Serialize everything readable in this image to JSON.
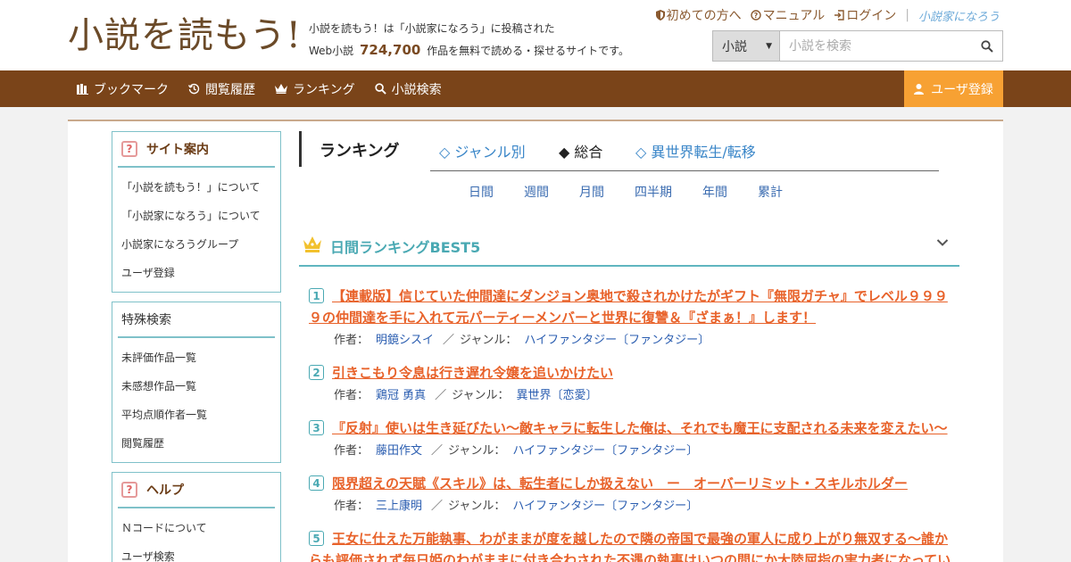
{
  "header": {
    "logo": "小説を読もう!",
    "tagline_1": "小説を読もう！は「小説家になろう」に投稿された",
    "tagline_2_prefix": "Web小説",
    "work_count": "724,700",
    "tagline_2_suffix": "作品を無料で読める・探せるサイトです。"
  },
  "topnav": {
    "beginners": "初めての方へ",
    "manual": "マニュアル",
    "login": "ログイン",
    "brand": "小説家になろう"
  },
  "search": {
    "select_value": "小説",
    "placeholder": "小説を検索"
  },
  "mainnav": {
    "bookmark": "ブックマーク",
    "history": "閲覧履歴",
    "ranking": "ランキング",
    "search": "小説検索",
    "register": "ユーザ登録"
  },
  "sidebar": {
    "site_guide": {
      "heading": "サイト案内",
      "items": [
        "「小説を読もう！」について",
        "「小説家になろう」について",
        "小説家になろうグループ",
        "ユーザ登録"
      ]
    },
    "special_search": {
      "heading": "特殊検索",
      "items": [
        "未評価作品一覧",
        "未感想作品一覧",
        "平均点順作者一覧",
        "閲覧履歴"
      ]
    },
    "help": {
      "heading": "ヘルプ",
      "items": [
        "Ｎコードについて",
        "ユーザ検索"
      ]
    }
  },
  "ranking": {
    "title": "ランキング",
    "tabs": [
      "◇ ジャンル別",
      "◆ 総合",
      "◇ 異世界転生/転移"
    ],
    "periods": [
      "日間",
      "週間",
      "月間",
      "四半期",
      "年間",
      "累計"
    ],
    "best_title": "日間ランキングBEST5",
    "author_label": "作者：",
    "genre_label": "ジャンル：",
    "entries": [
      {
        "rank": "1",
        "title": "【連載版】信じていた仲間達にダンジョン奥地で殺されかけたがギフト『無限ガチャ』でレベル９９９９の仲間達を手に入れて元パーティーメンバーと世界に復讐＆『ざまぁ！』します！",
        "author": "明鏡シスイ",
        "genre": "ハイファンタジー〔ファンタジー〕"
      },
      {
        "rank": "2",
        "title": "引きこもり令息は行き遅れ令嬢を追いかけたい",
        "author": "鶏冠 勇真",
        "genre": "異世界〔恋愛〕"
      },
      {
        "rank": "3",
        "title": "『反射』使いは生き延びたい～敵キャラに転生した俺は、それでも魔王に支配される未来を変えたい～",
        "author": "藤田作文",
        "genre": "ハイファンタジー〔ファンタジー〕"
      },
      {
        "rank": "4",
        "title": "限界超えの天賦《スキル》は、転生者にしか扱えない　ー　オーバーリミット・スキルホルダー",
        "author": "三上康明",
        "genre": "ハイファンタジー〔ファンタジー〕"
      },
      {
        "rank": "5",
        "title": "王女に仕えた万能執事、わがままが度を越したので隣の帝国で最強の軍人に成り上がり無双する〜誰からも評価されず毎日姫のわがままに付き合わされた不遇の執事はいつの間にか大陸屈指の実力者になってい",
        "author": "",
        "genre": ""
      }
    ]
  },
  "colors": {
    "brand_brown": "#7a4419",
    "accent_orange": "#f7a133",
    "teal": "#4aa9b3",
    "link_title": "#e8622a",
    "link_blue": "#2a5db0"
  }
}
